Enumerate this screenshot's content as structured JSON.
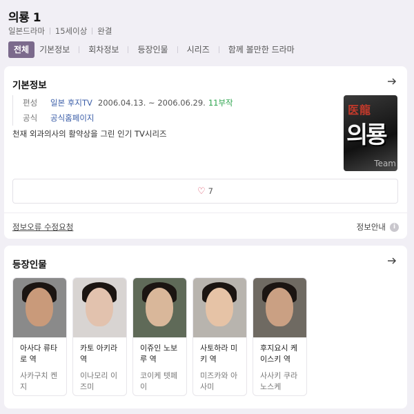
{
  "header": {
    "title": "의룡 1",
    "meta": [
      "일본드라마",
      "15세이상",
      "완결"
    ]
  },
  "tabs": [
    "전체",
    "기본정보",
    "회차정보",
    "등장인물",
    "시리즈",
    "함께 볼만한 드라마"
  ],
  "basic_info": {
    "title": "기본정보",
    "rows": {
      "broadcast_label": "편성",
      "broadcast_channel": "일본 후지TV",
      "broadcast_period": "2006.04.13. ~ 2006.06.29.",
      "episodes": "11부작",
      "official_label": "공식",
      "official_link": "공식홈페이지"
    },
    "description": "천재 외과의사의 활약상을 그린 인기 TV시리즈",
    "poster": {
      "hanja": "医龍",
      "big": "의룡",
      "team": "Team"
    },
    "likes": "7",
    "report_label": "정보오류 수정요청",
    "guide_label": "정보안내"
  },
  "cast": {
    "title": "등장인물",
    "people": [
      {
        "role": "아사다 류타로 역",
        "actor": "사카구치 켄지",
        "skin": "#c99a7a",
        "bg": "#8a8a8a"
      },
      {
        "role": "카토 아키라 역",
        "actor": "이나모리 이즈미",
        "skin": "#e2c2ae",
        "bg": "#d8d4d2"
      },
      {
        "role": "이쥬인 노보루 역",
        "actor": "코이케 텟페이",
        "skin": "#d9b79a",
        "bg": "#5f6a58"
      },
      {
        "role": "사토하라 미키 역",
        "actor": "미즈카와 아사미",
        "skin": "#e6c3a6",
        "bg": "#b8b4ae"
      },
      {
        "role": "후지요시 케이스키 역",
        "actor": "사사키 쿠라노스케",
        "skin": "#caa083",
        "bg": "#6f6a62"
      }
    ]
  },
  "colors": {
    "accent": "#7b6a8c",
    "link": "#3b5ea8",
    "green": "#2da44e",
    "heart": "#d9435a"
  }
}
